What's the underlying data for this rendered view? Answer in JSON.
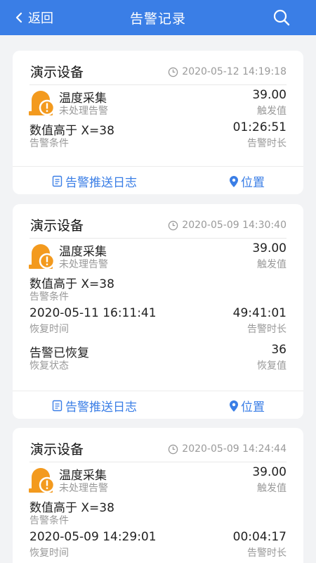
{
  "header": {
    "back_label": "返回",
    "title": "告警记录",
    "back_icon": "chevron-left-icon",
    "search_icon": "search-icon"
  },
  "colors": {
    "primary": "#3a7ee6",
    "alarm": "#f39a1e",
    "background": "#f2f3f5"
  },
  "cards": [
    {
      "device": "演示设备",
      "time": "2020-05-12 14:19:18",
      "alarm_type": "温度采集",
      "alarm_status": "未处理告警",
      "trigger_value": "39.00",
      "trigger_value_label": "触发值",
      "condition": "数值高于 X=38",
      "condition_label": "告警条件",
      "duration": "01:26:51",
      "duration_label": "告警时长",
      "log_label": "告警推送日志",
      "location_label": "位置"
    },
    {
      "device": "演示设备",
      "time": "2020-05-09 14:30:40",
      "alarm_type": "温度采集",
      "alarm_status": "未处理告警",
      "trigger_value": "39.00",
      "trigger_value_label": "触发值",
      "condition": "数值高于 X=38",
      "condition_label": "告警条件",
      "recover_time": "2020-05-11 16:11:41",
      "recover_time_label": "恢复时间",
      "duration": "49:41:01",
      "duration_label": "告警时长",
      "recover_state": "告警已恢复",
      "recover_state_label": "恢复状态",
      "recover_value": "36",
      "recover_value_label": "恢复值",
      "log_label": "告警推送日志",
      "location_label": "位置"
    },
    {
      "device": "演示设备",
      "time": "2020-05-09 14:24:44",
      "alarm_type": "温度采集",
      "alarm_status": "未处理告警",
      "trigger_value": "39.00",
      "trigger_value_label": "触发值",
      "condition": "数值高于 X=38",
      "condition_label": "告警条件",
      "recover_time": "2020-05-09 14:29:01",
      "recover_time_label": "恢复时间",
      "duration": "00:04:17",
      "duration_label": "告警时长"
    }
  ]
}
